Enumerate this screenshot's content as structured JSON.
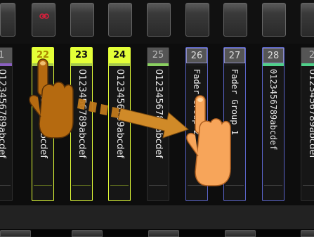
{
  "channels": [
    {
      "number": "1",
      "name": "0123456789abcdef",
      "number_style": "grey",
      "stripe": "#8a5fc0"
    },
    {
      "number": "22",
      "name": "0123456789abcdef",
      "number_style": "yellow",
      "stripe": "#a4c84a",
      "selected": true,
      "pending": true
    },
    {
      "number": "23",
      "name": "0123456789abcdef",
      "number_style": "yellow",
      "stripe": "#a4c84a",
      "selected": true
    },
    {
      "number": "24",
      "name": "0123456789abcdef",
      "number_style": "yellow",
      "stripe": "#a4c84a",
      "selected": true
    },
    {
      "number": "25",
      "name": "0123456789abcdef",
      "number_style": "grey",
      "stripe": "#8ad060"
    },
    {
      "number": "26",
      "name": "Fader Group 2",
      "number_style": "outline",
      "stripe": "#1a1a1a",
      "group": true
    },
    {
      "number": "27",
      "name": "Fader Group 1",
      "number_style": "outline",
      "stripe": "#1a1a1a",
      "group": true
    },
    {
      "number": "28",
      "name": "0123456789abcdef",
      "number_style": "outline",
      "stripe": "#4fd08a",
      "group": true
    },
    {
      "number": "2",
      "name": "0123456789abcdef",
      "number_style": "grey",
      "stripe": "#4fd08a"
    }
  ],
  "colors": {
    "selected_yellow": "#e4ff38",
    "group_blue": "#5a64c8",
    "link_red": "#d8203c",
    "hand_light": "#f7a55a",
    "hand_dark": "#b56a10",
    "arrow": "#d08a28"
  },
  "icons": {
    "link": "link-icon",
    "gesture": "drag-gesture-hand-icon"
  }
}
